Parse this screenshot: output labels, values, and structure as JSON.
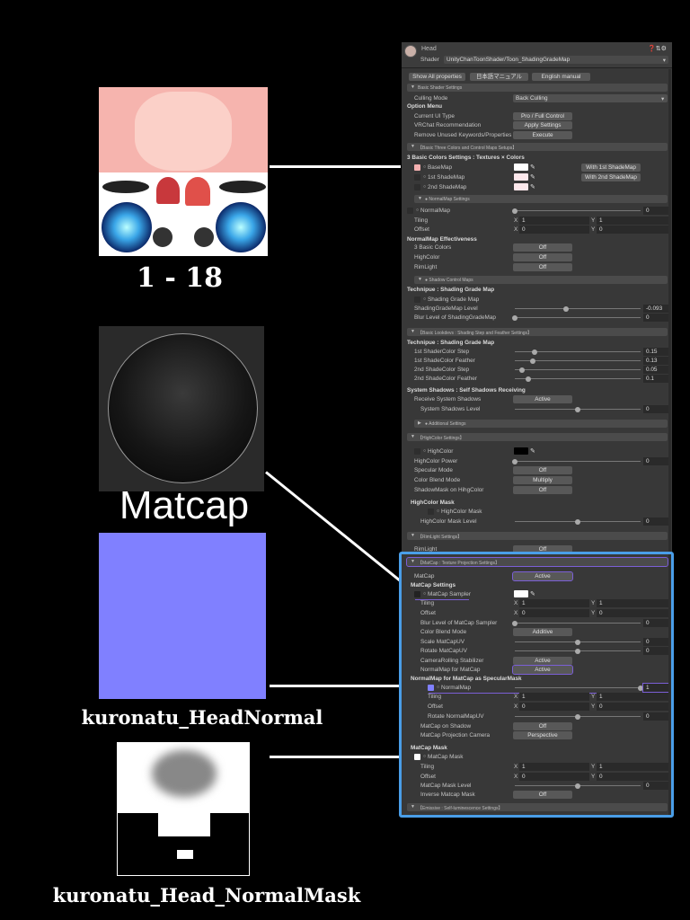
{
  "left": {
    "atlas_caption": "1 - 18",
    "matcap_caption": "Matcap",
    "normal_caption": "kuronatu_HeadNormal",
    "mask_caption": "kuronatu_Head_NormalMask",
    "normal_color": "#8080ff"
  },
  "inspector": {
    "object_name": "Head",
    "shader_label": "Shader",
    "shader_value": "UnityChanToonShader/Toon_ShadingGradeMap",
    "top_buttons": [
      "Show All properties",
      "日本語マニュアル",
      "English manual"
    ],
    "accent_blue": "#4a9ee8",
    "accent_purple": "#7b5fd6",
    "rows": [
      {
        "t": "sec",
        "label": "Basic Shader Settings"
      },
      {
        "t": "dd",
        "label": "Culling Mode",
        "value": "Back Culling",
        "ind": 1
      },
      {
        "t": "bold",
        "label": "Option Menu"
      },
      {
        "t": "btn",
        "label": "Current UI Type",
        "value": "Pro / Full Control",
        "ind": 1
      },
      {
        "t": "btn",
        "label": "VRChat Recommendation",
        "value": "Apply Settings",
        "ind": 1
      },
      {
        "t": "btn",
        "label": "Remove Unused Keywords/Properties",
        "value": "Execute",
        "ind": 1
      },
      {
        "t": "sec",
        "label": "【Basic Three Colors and Control Maps Setups】"
      },
      {
        "t": "bold",
        "label": "3 Basic Colors Settings : Textures × Colors"
      },
      {
        "t": "color",
        "label": "BaseMap",
        "color": "#ffffff",
        "side": "With 1st ShadeMap",
        "tex": "#f4b0b0"
      },
      {
        "t": "color",
        "label": "1st ShadeMap",
        "color": "#fde8ec",
        "side": "With 2nd ShadeMap"
      },
      {
        "t": "color",
        "label": "2nd ShadeMap",
        "color": "#fde8ec"
      },
      {
        "t": "sec",
        "label": "● NormalMap Settings",
        "sub": true
      },
      {
        "t": "slider",
        "label": "NormalMap",
        "value": "0",
        "frac": 0,
        "tex": true
      },
      {
        "t": "vec",
        "label": "Tiling",
        "x": "1",
        "y": "1",
        "ind": 1
      },
      {
        "t": "vec",
        "label": "Offset",
        "x": "0",
        "y": "0",
        "ind": 1
      },
      {
        "t": "bold",
        "label": "NormalMap Effectiveness"
      },
      {
        "t": "btn",
        "label": "3 Basic Colors",
        "value": "Off",
        "ind": 1
      },
      {
        "t": "btn",
        "label": "HighColor",
        "value": "Off",
        "ind": 1
      },
      {
        "t": "btn",
        "label": "RimLight",
        "value": "Off",
        "ind": 1
      },
      {
        "t": "sec",
        "label": "● Shadow Control Maps",
        "sub": true
      },
      {
        "t": "bold",
        "label": "Technipue : Shading Grade Map"
      },
      {
        "t": "texonly",
        "label": "Shading Grade Map"
      },
      {
        "t": "slider",
        "label": "ShadingGradeMap Level",
        "value": "-0.093",
        "frac": 0.41,
        "ind": 1
      },
      {
        "t": "slider",
        "label": "Blur Level of ShadingGradeMap",
        "value": "0",
        "frac": 0,
        "ind": 1
      },
      {
        "t": "sec",
        "label": "【Basic Lookdevs : Shading Step and Feather Settings】"
      },
      {
        "t": "bold",
        "label": "Technipue : Shading Grade Map"
      },
      {
        "t": "slider",
        "label": "1st ShaderColor Step",
        "value": "0.15",
        "frac": 0.16,
        "ind": 1
      },
      {
        "t": "slider",
        "label": "1st ShadeColor Feather",
        "value": "0.13",
        "frac": 0.14,
        "ind": 1
      },
      {
        "t": "slider",
        "label": "2nd ShadeColor Step",
        "value": "0.05",
        "frac": 0.06,
        "ind": 1
      },
      {
        "t": "slider",
        "label": "2nd ShadeColor Feather",
        "value": "0.1",
        "frac": 0.11,
        "ind": 1
      },
      {
        "t": "bold",
        "label": "System Shadows : Self Shadows Receiving"
      },
      {
        "t": "btn",
        "label": "Receive System Shadows",
        "value": "Active",
        "ind": 1
      },
      {
        "t": "slider",
        "label": "System Shadows Level",
        "value": "0",
        "frac": 0.5,
        "ind": 2
      },
      {
        "t": "sec",
        "label": "● Additional Settings",
        "sub": true,
        "collapsed": true
      },
      {
        "t": "sec",
        "label": "【HighColor Settings】"
      },
      {
        "t": "color",
        "label": "HighColor",
        "color": "#000000"
      },
      {
        "t": "slider",
        "label": "HighColor Power",
        "value": "0",
        "frac": 0,
        "ind": 1
      },
      {
        "t": "btn",
        "label": "Specular Mode",
        "value": "Off",
        "ind": 1
      },
      {
        "t": "btn",
        "label": "Color Blend Mode",
        "value": "Multiply",
        "ind": 1
      },
      {
        "t": "btn",
        "label": "ShadowMask on HihgColor",
        "value": "Off",
        "ind": 1
      },
      {
        "t": "bold",
        "label": "HighColor Mask",
        "ind": 1
      },
      {
        "t": "texonly",
        "label": "HighColor Mask",
        "ind": 3
      },
      {
        "t": "slider",
        "label": "HighColor Mask Level",
        "value": "0",
        "frac": 0.5,
        "ind": 2
      },
      {
        "t": "sec",
        "label": "【RimLight Settings】"
      },
      {
        "t": "btn",
        "label": "RimLight",
        "value": "Off",
        "ind": 1
      },
      {
        "t": "sec",
        "label": "【MatCap : Texture Projection Settings】",
        "hl": true
      },
      {
        "t": "btn",
        "label": "MatCap",
        "value": "Active",
        "ind": 1,
        "hl": true
      },
      {
        "t": "bold",
        "label": "MatCap Settings",
        "ind": 1
      },
      {
        "t": "color",
        "label": "MatCap Sampler",
        "color": "#ffffff",
        "ul": true,
        "tex": "#222222"
      },
      {
        "t": "vec",
        "label": "Tiling",
        "x": "1",
        "y": "1",
        "ind": 2
      },
      {
        "t": "vec",
        "label": "Offset",
        "x": "0",
        "y": "0",
        "ind": 2
      },
      {
        "t": "slider",
        "label": "Blur Level of MatCap Sampler",
        "value": "0",
        "frac": 0,
        "ind": 2
      },
      {
        "t": "btn",
        "label": "Color Blend Mode",
        "value": "Additive",
        "ind": 2
      },
      {
        "t": "slider",
        "label": "Scale MatCapUV",
        "value": "0",
        "frac": 0.5,
        "ind": 2
      },
      {
        "t": "slider",
        "label": "Rotate MatCapUV",
        "value": "0",
        "frac": 0.5,
        "ind": 2
      },
      {
        "t": "btn",
        "label": "CameraRolling Stabilizer",
        "value": "Active",
        "ind": 2
      },
      {
        "t": "btn",
        "label": "NormalMap for MatCap",
        "value": "Active",
        "ind": 2,
        "hl": true
      },
      {
        "t": "bold",
        "label": "NormalMap for MatCap as SpecularMask",
        "ind": 1
      },
      {
        "t": "slider",
        "label": "NormalMap",
        "value": "1",
        "frac": 1,
        "tex": "#8080ff",
        "ind": 3,
        "ul": true,
        "hl": true
      },
      {
        "t": "vec",
        "label": "Tiling",
        "x": "1",
        "y": "1",
        "ind": 3
      },
      {
        "t": "vec",
        "label": "Offset",
        "x": "0",
        "y": "0",
        "ind": 3
      },
      {
        "t": "slider",
        "label": "Rotate NormalMapUV",
        "value": "0",
        "frac": 0.5,
        "ind": 3
      },
      {
        "t": "btn",
        "label": "MatCap on Shadow",
        "value": "Off",
        "ind": 2
      },
      {
        "t": "btn",
        "label": "MatCap Projection Camera",
        "value": "Perspective",
        "ind": 2
      },
      {
        "t": "bold",
        "label": "MatCap Mask",
        "ind": 1
      },
      {
        "t": "texonly",
        "label": "MatCap Mask",
        "tex": "#ffffff"
      },
      {
        "t": "vec",
        "label": "Tiling",
        "x": "1",
        "y": "1",
        "ind": 2
      },
      {
        "t": "vec",
        "label": "Offset",
        "x": "0",
        "y": "0",
        "ind": 2
      },
      {
        "t": "slider",
        "label": "MatCap Mask Level",
        "value": "0",
        "frac": 0.5,
        "ind": 2
      },
      {
        "t": "btn",
        "label": "Inverse Matcap Mask",
        "value": "Off",
        "ind": 2
      },
      {
        "t": "sec",
        "label": "【Emissive : Self-luminescence Settings】"
      }
    ]
  }
}
